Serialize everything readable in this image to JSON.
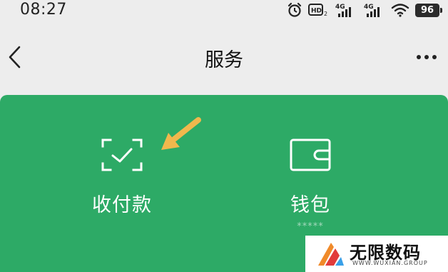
{
  "status_bar": {
    "time": "08:27",
    "hd_label": "HD",
    "network_1": "4G",
    "network_2": "4G",
    "battery_level": "96"
  },
  "nav": {
    "title": "服务"
  },
  "services": {
    "pay": {
      "label": "收付款",
      "icon": "scan-qr-icon"
    },
    "wallet": {
      "label": "钱包",
      "icon": "wallet-icon",
      "balance": "*****"
    }
  },
  "watermark": {
    "name": "无限数码",
    "site": "WWW.WUXIAN.GROUP"
  },
  "colors": {
    "panel": "#2daa66",
    "arrow": "#f0b84d",
    "background": "#ededed"
  }
}
